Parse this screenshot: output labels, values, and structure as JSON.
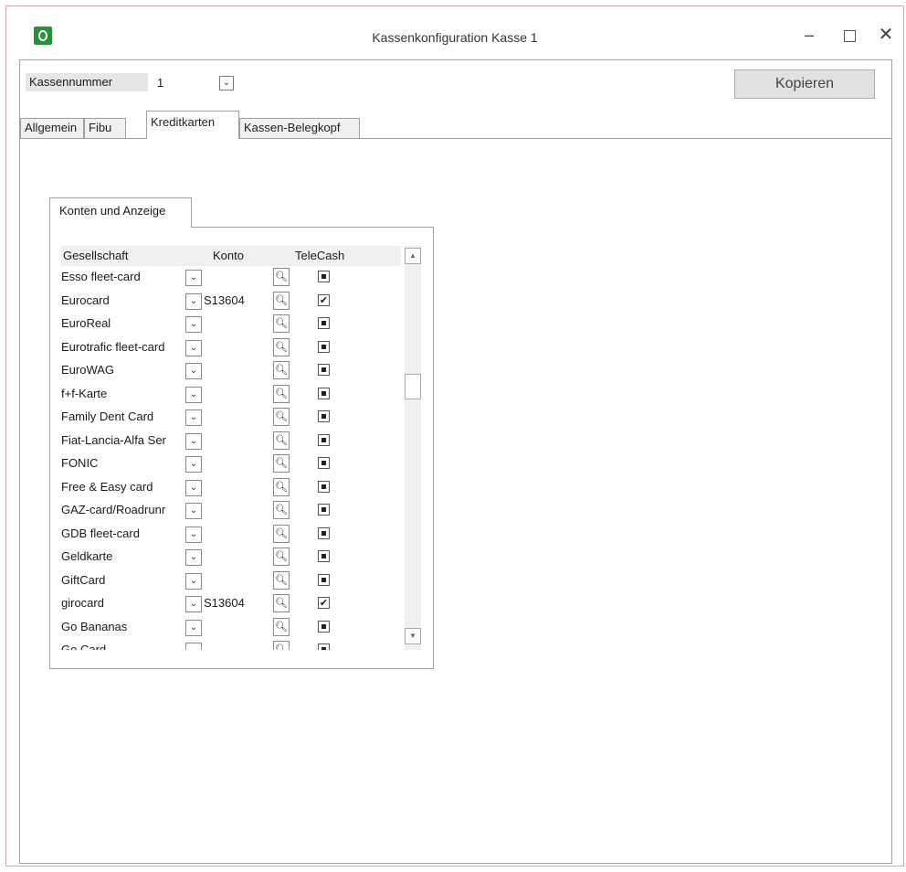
{
  "window": {
    "title": "Kassenkonfiguration Kasse 1",
    "minimize_glyph": "–",
    "close_glyph": "✕"
  },
  "header": {
    "kassennummer_label": "Kassennummer",
    "kassennummer_value": "1",
    "kopieren_label": "Kopieren"
  },
  "tabs": [
    {
      "label": "Allgemein",
      "active": false
    },
    {
      "label": "Fibu",
      "active": false
    },
    {
      "label": "Kreditkarten",
      "active": true
    },
    {
      "label": "Kassen-Belegkopf",
      "active": false
    }
  ],
  "group": {
    "tab_label": "Konten und Anzeige",
    "columns": [
      "Gesellschaft",
      "Konto",
      "TeleCash"
    ],
    "rows": [
      {
        "name": "Esso fleet-card",
        "konto": "",
        "checked": false
      },
      {
        "name": "Eurocard",
        "konto": "S13604",
        "checked": true
      },
      {
        "name": "EuroReal",
        "konto": "",
        "checked": false
      },
      {
        "name": "Eurotrafic fleet-card",
        "konto": "",
        "checked": false
      },
      {
        "name": "EuroWAG",
        "konto": "",
        "checked": false
      },
      {
        "name": "f+f-Karte",
        "konto": "",
        "checked": false
      },
      {
        "name": "Family Dent Card",
        "konto": "",
        "checked": false
      },
      {
        "name": "Fiat-Lancia-Alfa Ser",
        "konto": "",
        "checked": false
      },
      {
        "name": "FONIC",
        "konto": "",
        "checked": false
      },
      {
        "name": "Free & Easy card",
        "konto": "",
        "checked": false
      },
      {
        "name": "GAZ-card/Roadrunr",
        "konto": "",
        "checked": false
      },
      {
        "name": "GDB fleet-card",
        "konto": "",
        "checked": false
      },
      {
        "name": "Geldkarte",
        "konto": "",
        "checked": false
      },
      {
        "name": "GiftCard",
        "konto": "",
        "checked": false
      },
      {
        "name": "girocard",
        "konto": "S13604",
        "checked": true
      },
      {
        "name": "Go Bananas",
        "konto": "",
        "checked": false
      },
      {
        "name": "Go Card",
        "konto": "",
        "checked": false
      }
    ]
  },
  "icons": {
    "dropdown": "chevron-down-icon",
    "search": "search-icon",
    "check": "checkmark-icon",
    "scroll_up": "scroll-up-icon",
    "scroll_down": "scroll-down-icon"
  }
}
